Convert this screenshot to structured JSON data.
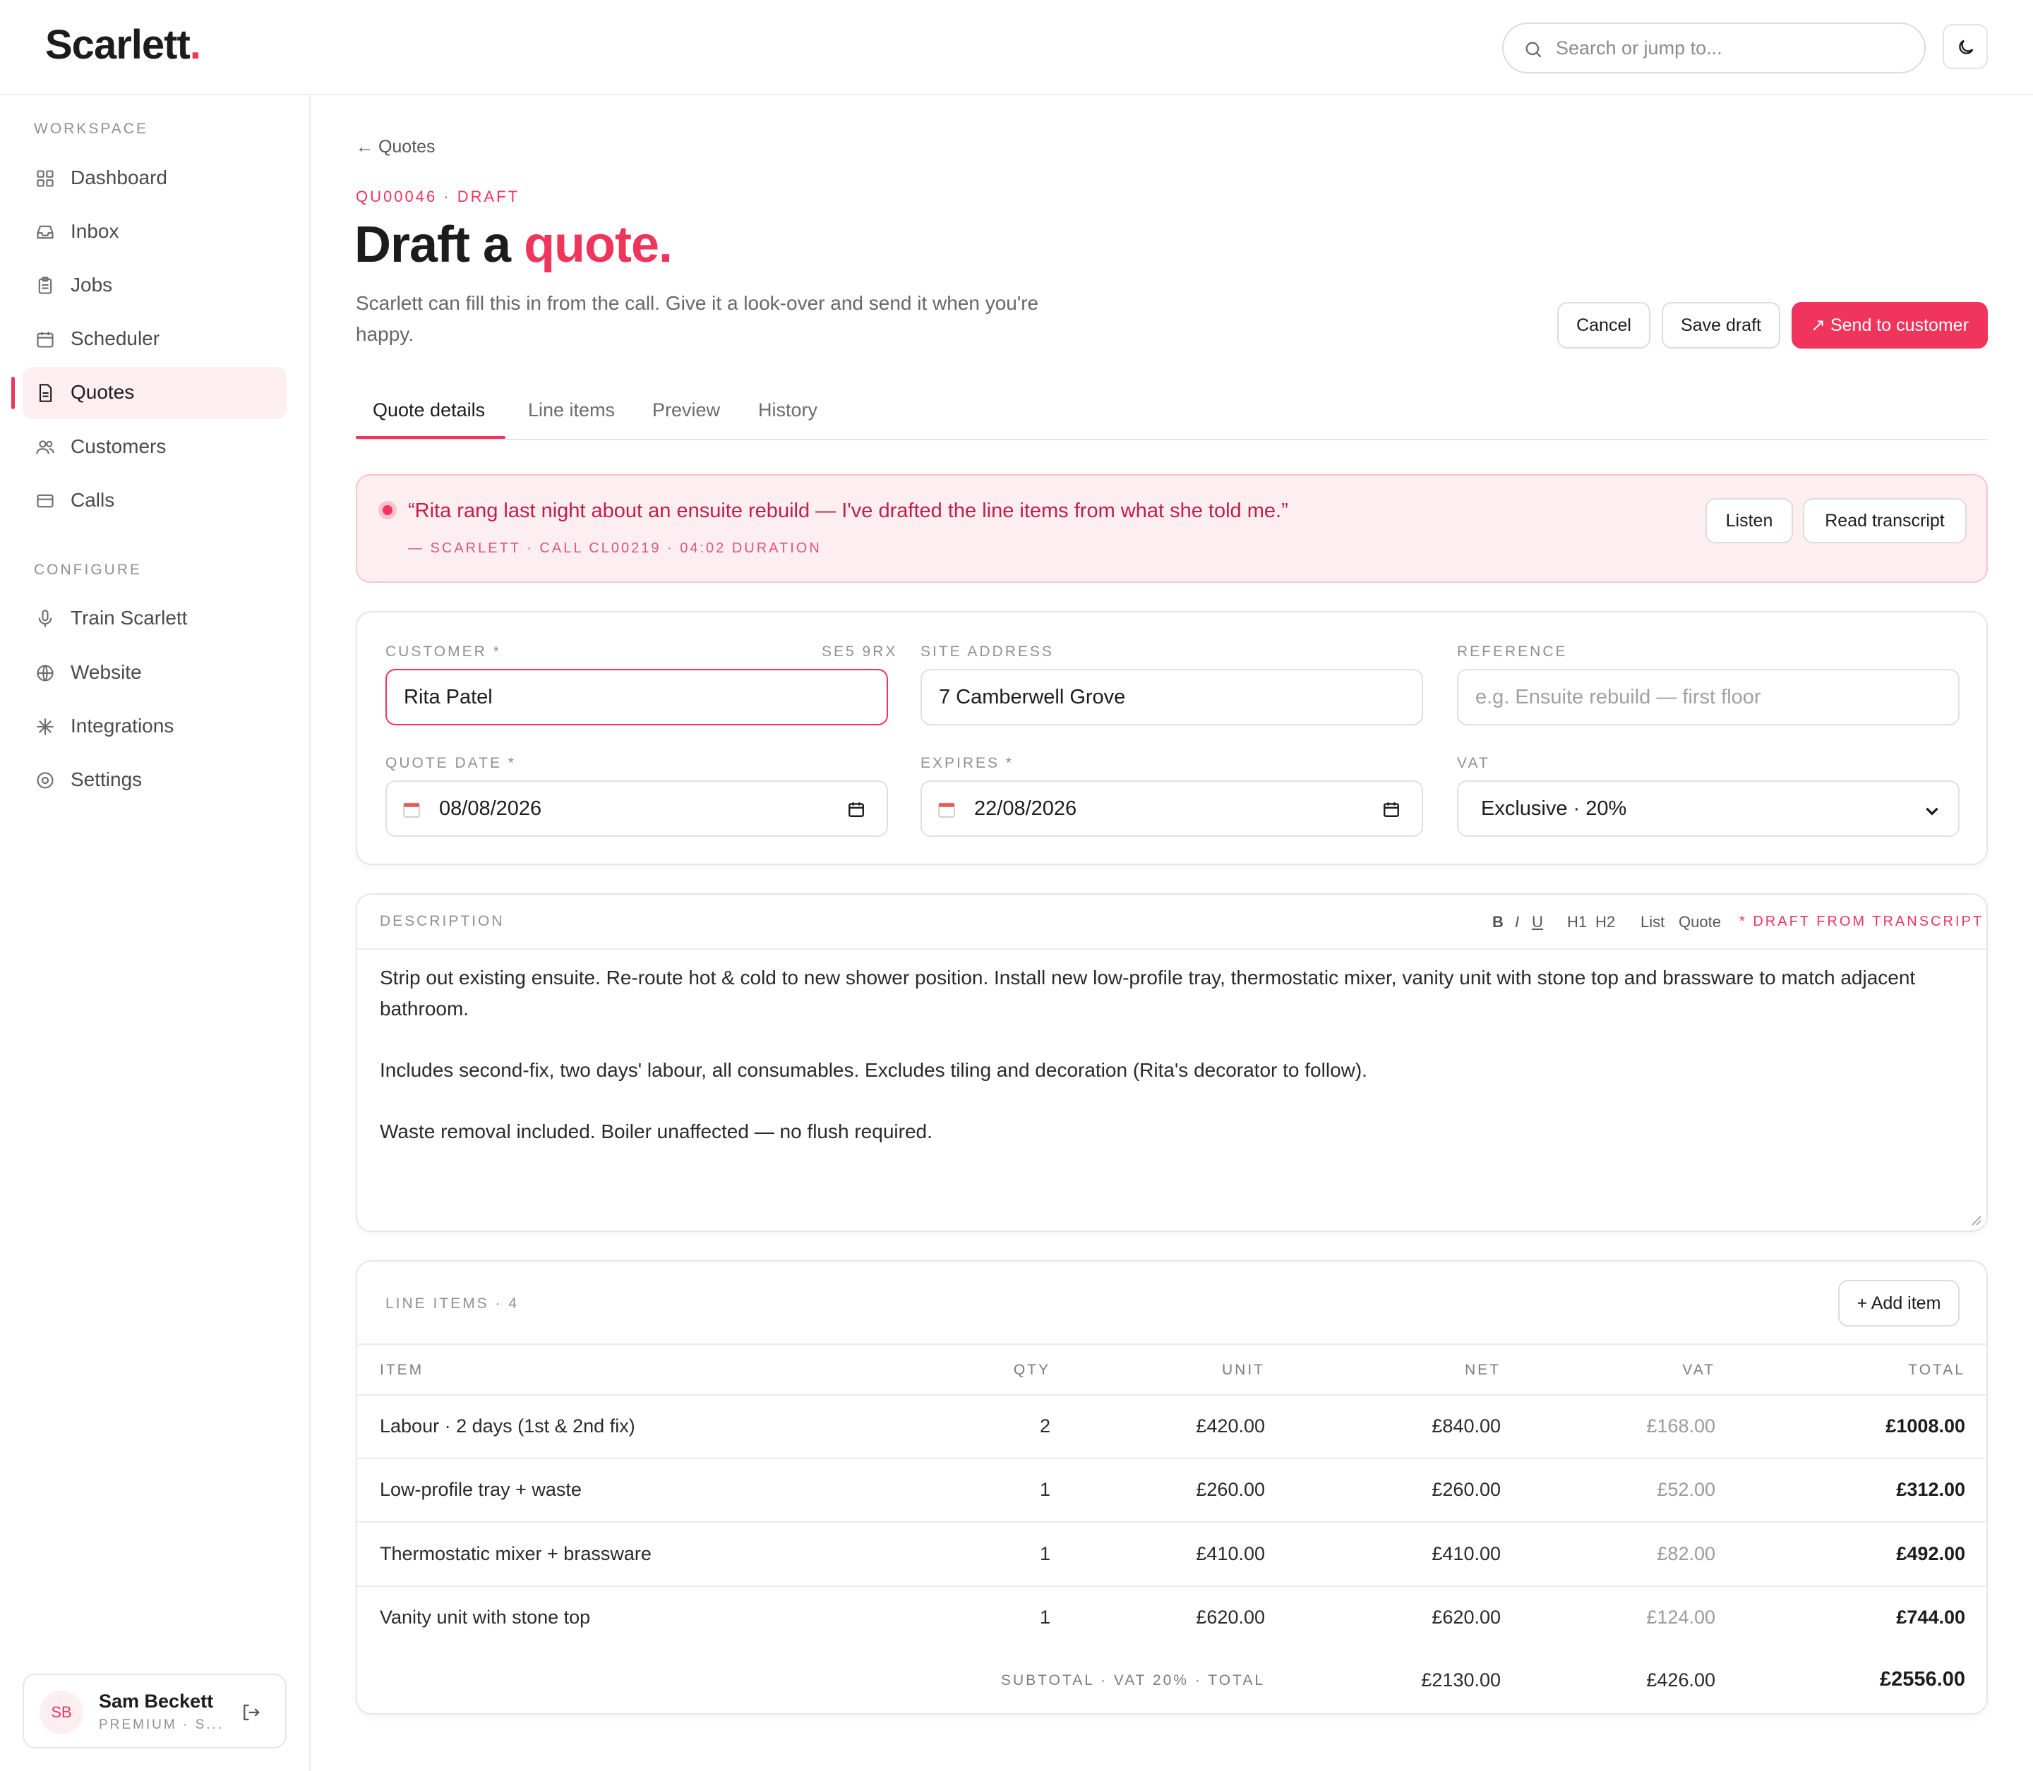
{
  "app": {
    "logo_text": "Scarlett",
    "logo_dot": ".",
    "search_placeholder": "Search or jump to...",
    "accent_color": "#f0345b"
  },
  "sidebar": {
    "section_workspace": "WORKSPACE",
    "section_configure": "CONFIGURE",
    "workspace_items": [
      {
        "label": "Dashboard",
        "icon": "grid-icon"
      },
      {
        "label": "Inbox",
        "icon": "inbox-icon"
      },
      {
        "label": "Jobs",
        "icon": "clipboard-icon"
      },
      {
        "label": "Scheduler",
        "icon": "calendar-icon"
      },
      {
        "label": "Quotes",
        "icon": "document-icon",
        "active": true
      },
      {
        "label": "Customers",
        "icon": "users-icon"
      },
      {
        "label": "Calls",
        "icon": "card-icon"
      }
    ],
    "configure_items": [
      {
        "label": "Train Scarlett",
        "icon": "microphone-icon"
      },
      {
        "label": "Website",
        "icon": "globe-icon"
      },
      {
        "label": "Integrations",
        "icon": "sparkle-icon"
      },
      {
        "label": "Settings",
        "icon": "settings-icon"
      }
    ],
    "user": {
      "initials": "SB",
      "name": "Sam Beckett",
      "plan": "PREMIUM · S..."
    }
  },
  "page": {
    "back_label": "← Quotes",
    "eyebrow": "QU00046 · DRAFT",
    "title_main": "Draft a ",
    "title_accent": "quote.",
    "subtitle": "Scarlett can fill this in from the call. Give it a look-over and send it when you're happy.",
    "buttons": {
      "cancel": "Cancel",
      "save": "Save draft",
      "send": "↗ Send to customer"
    },
    "tabs": [
      "Quote details",
      "Line items",
      "Preview",
      "History"
    ],
    "active_tab": "Quote details"
  },
  "banner": {
    "quote": "“Rita rang last night about an ensuite rebuild — I've drafted the line items from what she told me.”",
    "meta": "— SCARLETT · CALL CL00219 · 04:02 DURATION",
    "listen": "Listen",
    "transcript": "Read transcript"
  },
  "form": {
    "customer_label": "CUSTOMER *",
    "customer_postcode": "SE5 9RX",
    "customer_value": "Rita Patel",
    "site_label": "SITE ADDRESS",
    "site_value": "7 Camberwell Grove",
    "reference_label": "REFERENCE",
    "reference_placeholder": "e.g. Ensuite rebuild — first floor",
    "quote_date_label": "QUOTE DATE *",
    "quote_date_value": "08/08/2026",
    "expires_label": "EXPIRES *",
    "expires_value": "22/08/2026",
    "vat_label": "VAT",
    "vat_value": "Exclusive · 20%"
  },
  "description": {
    "label": "DESCRIPTION",
    "toolbar": [
      "B",
      "I",
      "U",
      "H1",
      "H2",
      "List",
      "Quote"
    ],
    "draft_badge": "* DRAFT FROM TRANSCRIPT",
    "paragraphs": [
      "Strip out existing ensuite. Re-route hot & cold to new shower position. Install new low-profile tray, thermostatic mixer, vanity unit with stone top and brassware to match adjacent bathroom.",
      "Includes second-fix, two days' labour, all consumables. Excludes tiling and decoration (Rita's decorator to follow).",
      "Waste removal included. Boiler unaffected — no flush required."
    ]
  },
  "line_items": {
    "title": "LINE ITEMS · 4",
    "add_label": "+ Add item",
    "columns": [
      "ITEM",
      "QTY",
      "UNIT",
      "NET",
      "VAT",
      "TOTAL"
    ],
    "rows": [
      {
        "item": "Labour · 2 days (1st & 2nd fix)",
        "qty": "2",
        "unit": "£420.00",
        "net": "£840.00",
        "vat": "£168.00",
        "total": "£1008.00"
      },
      {
        "item": "Low-profile tray + waste",
        "qty": "1",
        "unit": "£260.00",
        "net": "£260.00",
        "vat": "£52.00",
        "total": "£312.00"
      },
      {
        "item": "Thermostatic mixer + brassware",
        "qty": "1",
        "unit": "£410.00",
        "net": "£410.00",
        "vat": "£82.00",
        "total": "£492.00"
      },
      {
        "item": "Vanity unit with stone top",
        "qty": "1",
        "unit": "£620.00",
        "net": "£620.00",
        "vat": "£124.00",
        "total": "£744.00"
      }
    ],
    "footer_label": "SUBTOTAL · VAT 20% · TOTAL",
    "subtotal": "£2130.00",
    "vat_total": "£426.00",
    "grand_total": "£2556.00"
  }
}
